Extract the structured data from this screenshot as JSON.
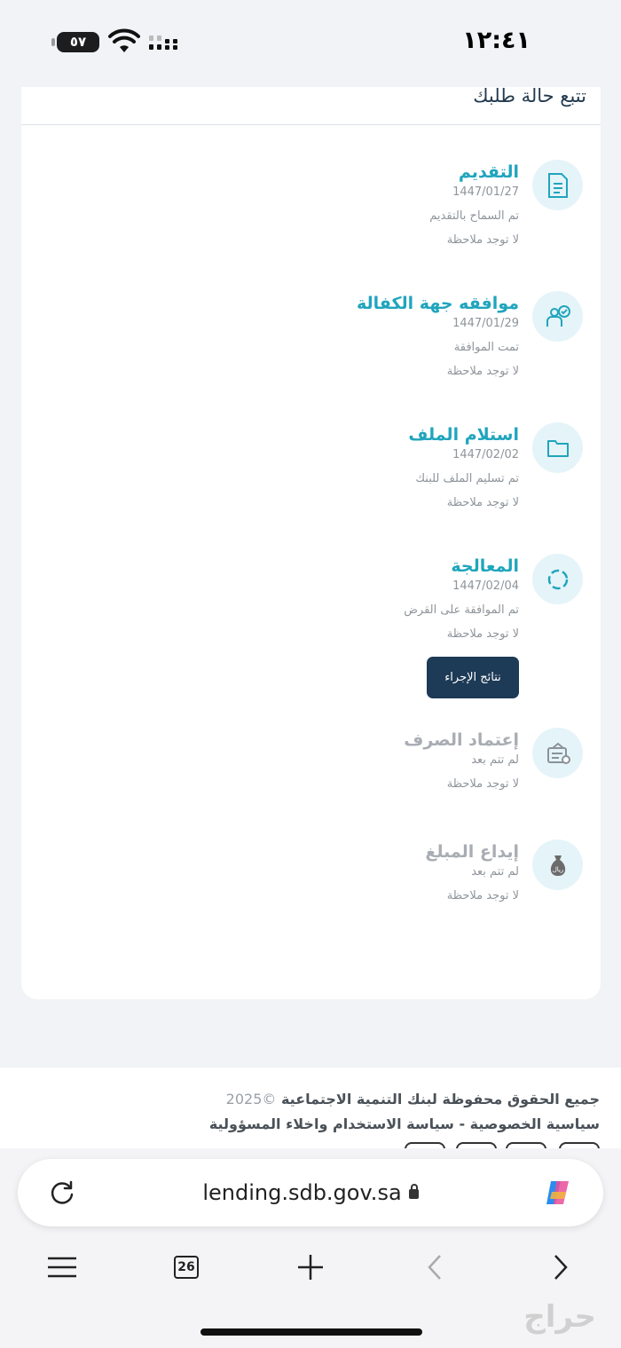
{
  "status_bar": {
    "time": "١٢:٤١",
    "battery": "٥٧"
  },
  "card": {
    "title": "تتبع حالة طلبك"
  },
  "steps": [
    {
      "title": "التقديم",
      "date": "1447/01/27",
      "status": "تم السماح بالتقديم",
      "note": "لا توجد ملاحظة",
      "icon": "document-icon",
      "done": true
    },
    {
      "title": "موافقه جهة الكفالة",
      "date": "1447/01/29",
      "status": "تمت الموافقة",
      "note": "لا توجد ملاحظة",
      "icon": "guarantor-approval-icon",
      "done": true
    },
    {
      "title": "استلام الملف",
      "date": "1447/02/02",
      "status": "تم تسليم الملف للبنك",
      "note": "لا توجد ملاحظة",
      "icon": "folder-icon",
      "done": true
    },
    {
      "title": "المعالجة",
      "date": "1447/02/04",
      "status": "تم الموافقة على القرض",
      "note": "لا توجد ملاحظة",
      "icon": "processing-icon",
      "done": true
    },
    {
      "title": "إعتماد الصرف",
      "date": "",
      "status": "لم تتم بعد",
      "note": "لا توجد ملاحظة",
      "icon": "disbursement-icon",
      "done": false
    },
    {
      "title": "إيداع المبلغ",
      "date": "",
      "status": "لم تتم بعد",
      "note": "لا توجد ملاحظة",
      "icon": "money-bag-icon",
      "done": false
    }
  ],
  "result_button": "نتائج الإجراء",
  "footer": {
    "rights": "جميع الحقوق محفوظة لبنك التنمية الاجتماعية",
    "year": "©2025",
    "links": "سياسية الخصوصية - سياسة الاستخدام واخلاء المسؤولية"
  },
  "browser": {
    "url": "lending.sdb.gov.sa",
    "tab_count": "26"
  },
  "watermark": "حراج",
  "colors": {
    "accent": "#20a5bd",
    "button": "#1d3a56",
    "icon_bg": "#e5f4f8"
  }
}
